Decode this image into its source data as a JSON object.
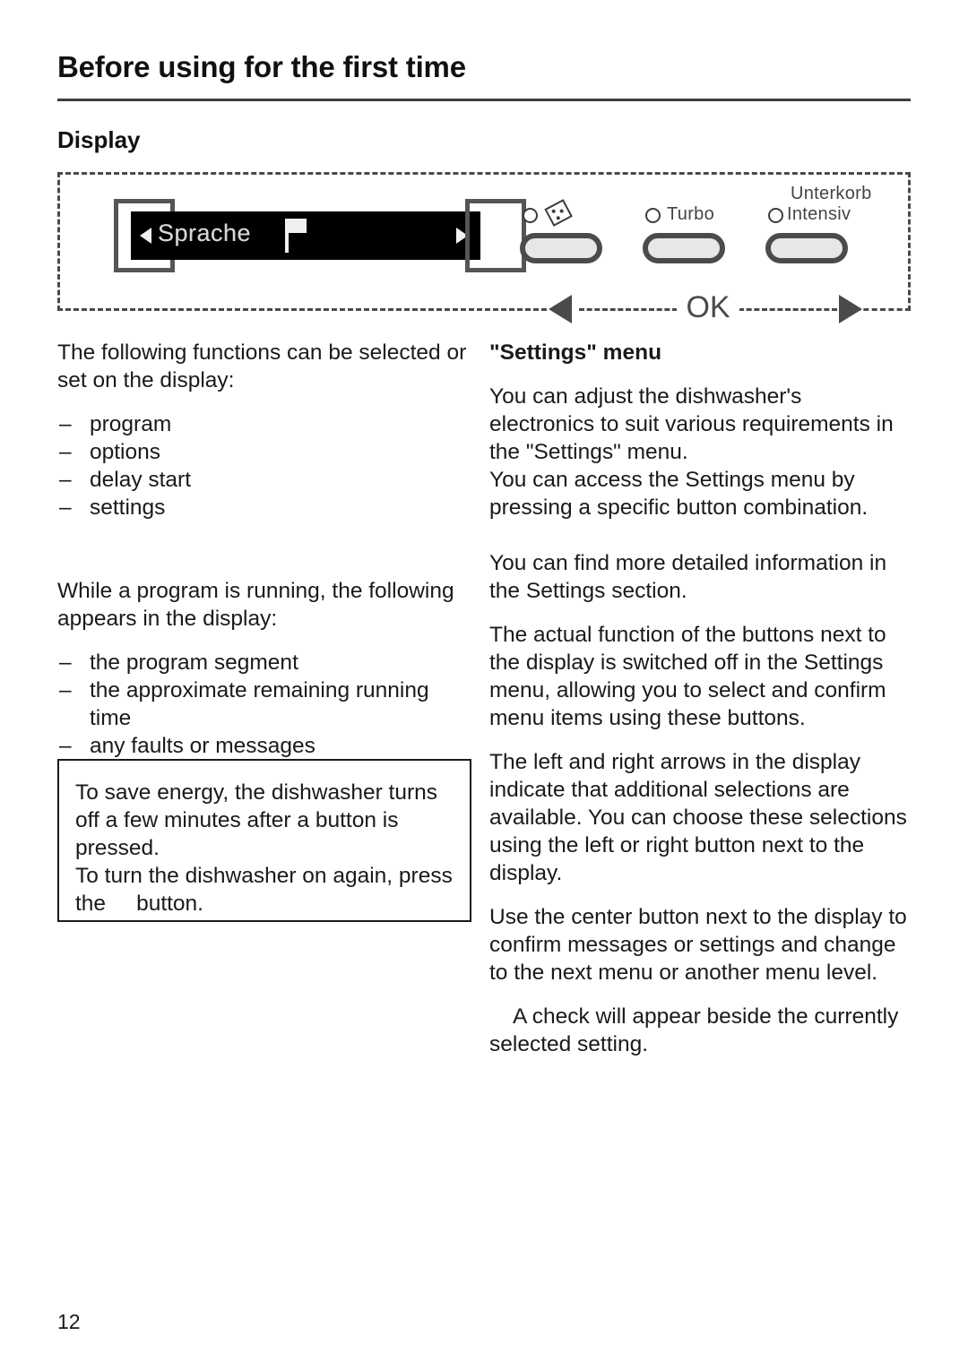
{
  "header": {
    "chapter_title": "Before using for the first time",
    "section_title": "Display"
  },
  "figure": {
    "display": {
      "text": "Sprache",
      "left_arrow_icon": "triangle-left-icon",
      "right_arrow_icon": "triangle-right-icon",
      "flag_icon": "flag-icon"
    },
    "side_buttons": {
      "left": "left-select-button",
      "right": "right-select-button"
    },
    "option_buttons": [
      {
        "label": "",
        "icon": "sparkle-icon",
        "indicator": "indicator-led"
      },
      {
        "label": "Turbo",
        "icon": "",
        "indicator": "indicator-led"
      },
      {
        "label_line1": "Unterkorb",
        "label_line2": "Intensiv",
        "icon": "",
        "indicator": "indicator-led"
      }
    ],
    "callout": {
      "left_arrow": "arrow-left-marker",
      "ok": "OK",
      "right_arrow": "arrow-right-marker"
    }
  },
  "left_column": {
    "intro": "The following functions can be selected or set on the display:",
    "dash": "–",
    "functions": [
      "program",
      "options",
      "delay start",
      "settings"
    ],
    "running_intro": "While a program is running, the following appears in the display:",
    "running_items": [
      "the program segment",
      "the approximate remaining running time",
      "any faults or messages"
    ],
    "note_line1": "To save energy, the dishwasher turns off a few minutes after a button is pressed.",
    "note_line2_a": "To turn the dishwasher on again, press the",
    "note_line2_b": "button."
  },
  "right_column": {
    "heading": "\"Settings\" menu",
    "paragraphs": [
      "You can adjust the dishwasher's electronics to suit various requirements in the \"Settings\" menu.",
      "You can access the Settings menu by pressing a specific button combination.",
      "You can find more detailed information in the Settings section.",
      "The actual function of the buttons next to the display is switched off in the Settings menu, allowing you to select and confirm menu items using these buttons.",
      "The left and right arrows in the display indicate that additional selections are available. You can choose these selections using the left or right button next to the display.",
      "Use the center button next to the display to confirm messages or settings and change to the next menu or another menu level.",
      "A check will appear beside the currently selected setting."
    ]
  },
  "footer": {
    "page_number": "12"
  }
}
